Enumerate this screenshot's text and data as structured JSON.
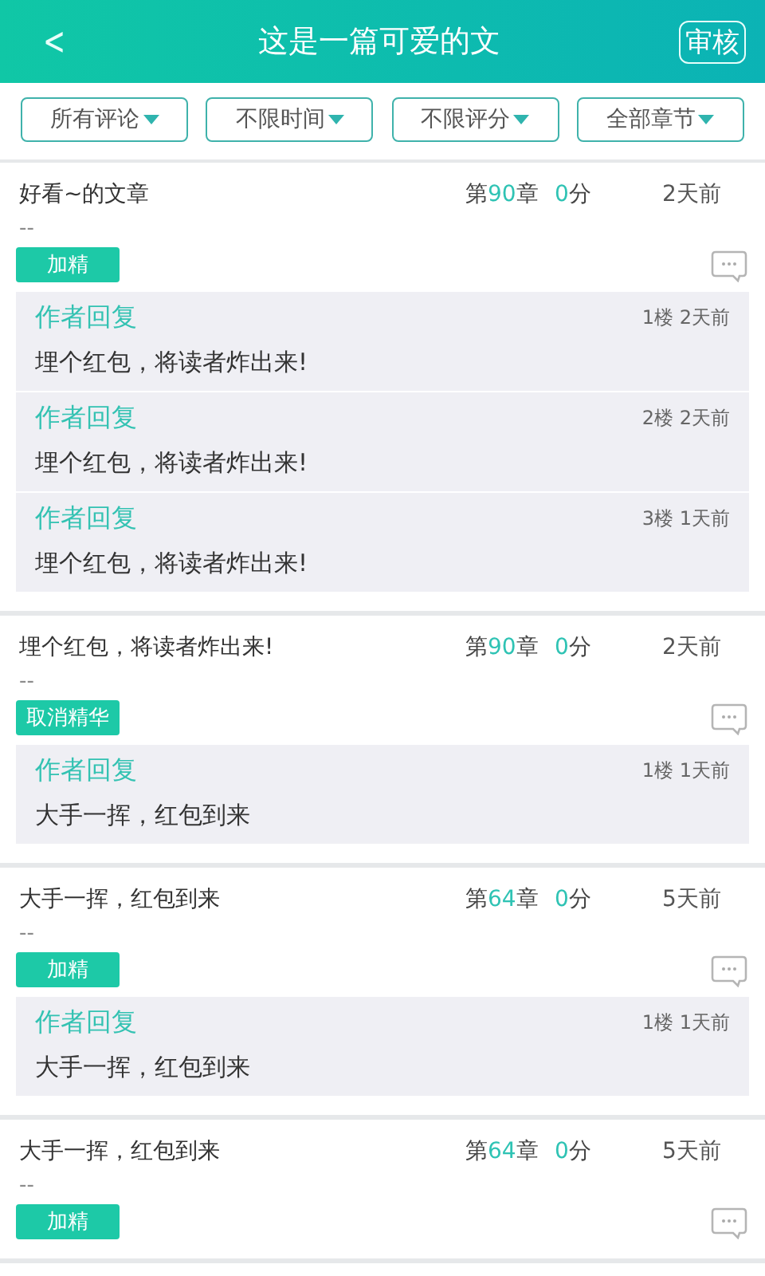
{
  "header": {
    "back": "<",
    "title": "这是一篇可爱的文",
    "action": "审核"
  },
  "filters": [
    {
      "label": "所有评论"
    },
    {
      "label": "不限时间"
    },
    {
      "label": "不限评分"
    },
    {
      "label": "全部章节"
    }
  ],
  "comments": [
    {
      "text": "好看~的文章",
      "chapter": {
        "prefix": "第",
        "number": "90",
        "suffix": "章"
      },
      "score": {
        "number": "0",
        "unit": "分"
      },
      "time": "2天前",
      "subtext": "--",
      "tag": "加精",
      "replies": [
        {
          "author": "作者回复",
          "meta": "1楼 2天前",
          "text": "埋个红包，将读者炸出来!"
        },
        {
          "author": "作者回复",
          "meta": "2楼 2天前",
          "text": "埋个红包，将读者炸出来!"
        },
        {
          "author": "作者回复",
          "meta": "3楼 1天前",
          "text": "埋个红包，将读者炸出来!"
        }
      ]
    },
    {
      "text": "埋个红包，将读者炸出来!",
      "chapter": {
        "prefix": "第",
        "number": "90",
        "suffix": "章"
      },
      "score": {
        "number": "0",
        "unit": "分"
      },
      "time": "2天前",
      "subtext": "--",
      "tag": "取消精华",
      "replies": [
        {
          "author": "作者回复",
          "meta": "1楼 1天前",
          "text": "大手一挥，红包到来"
        }
      ]
    },
    {
      "text": "大手一挥，红包到来",
      "chapter": {
        "prefix": "第",
        "number": "64",
        "suffix": "章"
      },
      "score": {
        "number": "0",
        "unit": "分"
      },
      "time": "5天前",
      "subtext": "--",
      "tag": "加精",
      "replies": [
        {
          "author": "作者回复",
          "meta": "1楼 1天前",
          "text": "大手一挥，红包到来"
        }
      ]
    },
    {
      "text": "大手一挥，红包到来",
      "chapter": {
        "prefix": "第",
        "number": "64",
        "suffix": "章"
      },
      "score": {
        "number": "0",
        "unit": "分"
      },
      "time": "5天前",
      "subtext": "--",
      "tag": "加精"
    }
  ]
}
